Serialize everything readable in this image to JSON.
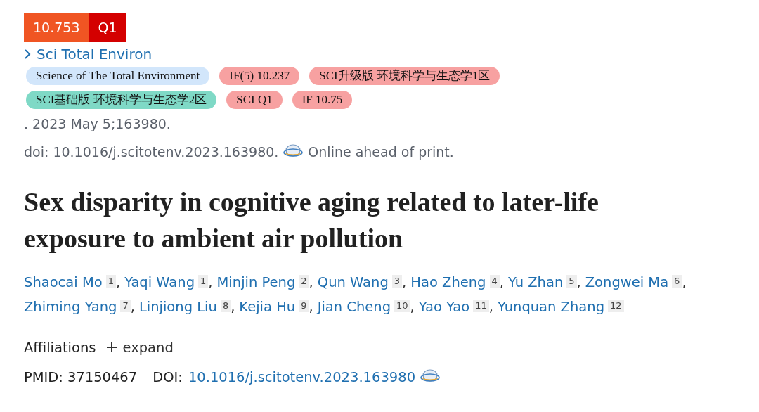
{
  "impact_badge": {
    "value": "10.753",
    "quartile": "Q1"
  },
  "journal_link": {
    "text": "Sci Total Environ"
  },
  "tag_rows": [
    [
      {
        "text": "Science of The Total Environment",
        "color": "#d2e6fb"
      },
      {
        "text": "IF(5) 10.237",
        "color": "#f7a1a1"
      },
      {
        "text": "SCI升级版 环境科学与生态学1区",
        "color": "#f7a1a1"
      }
    ],
    [
      {
        "text": "SCI基础版 环境科学与生态学2区",
        "color": "#7fd9c6"
      },
      {
        "text": "SCI Q1",
        "color": "#f7a1a1"
      },
      {
        "text": "IF 10.75",
        "color": "#f7a1a1"
      }
    ]
  ],
  "date_line": ". 2023 May 5;163980.",
  "doi_line": {
    "text": "doi: 10.1016/j.scitotenv.2023.163980.",
    "note": "Online ahead of print."
  },
  "title": "Sex disparity in cognitive aging related to later-life exposure to ambient air pollution",
  "author_lines": [
    [
      {
        "name": "Shaocai Mo",
        "aff": "1",
        "sep": ","
      },
      {
        "name": "Yaqi Wang",
        "aff": "1",
        "sep": ","
      },
      {
        "name": "Minjin Peng",
        "aff": "2",
        "sep": ","
      },
      {
        "name": "Qun Wang",
        "aff": "3",
        "sep": ","
      },
      {
        "name": "Hao Zheng",
        "aff": "4",
        "sep": ","
      },
      {
        "name": "Yu Zhan",
        "aff": "5",
        "sep": ","
      },
      {
        "name": "Zongwei Ma",
        "aff": "6",
        "sep": ","
      }
    ],
    [
      {
        "name": "Zhiming Yang",
        "aff": "7",
        "sep": ","
      },
      {
        "name": "Linjiong Liu",
        "aff": "8",
        "sep": ","
      },
      {
        "name": "Kejia Hu",
        "aff": "9",
        "sep": ","
      },
      {
        "name": "Jian Cheng",
        "aff": "10",
        "sep": ","
      },
      {
        "name": "Yao Yao",
        "aff": "11",
        "sep": ","
      },
      {
        "name": "Yunquan Zhang",
        "aff": "12"
      }
    ]
  ],
  "affiliations": {
    "label": "Affiliations",
    "toggle": "expand"
  },
  "identifiers": {
    "pmid_label": "PMID:",
    "pmid": "37150467",
    "doi_label": "DOI:",
    "doi": "10.1016/j.scitotenv.2023.163980"
  }
}
